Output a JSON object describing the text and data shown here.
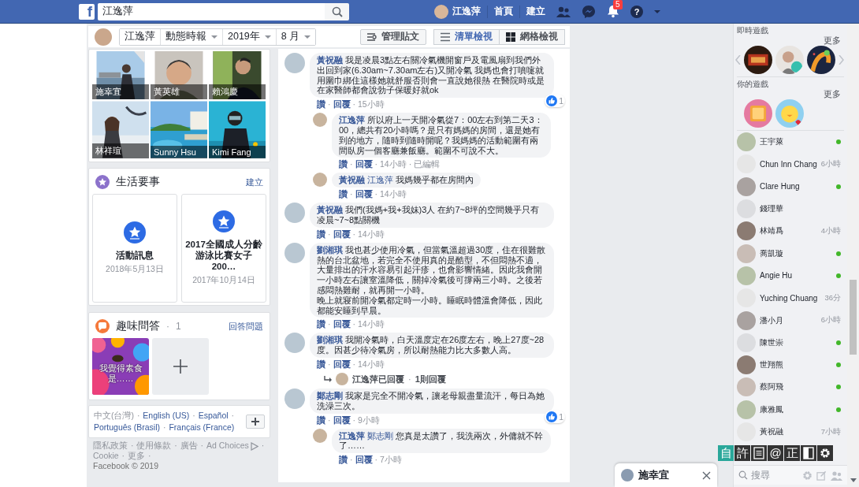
{
  "separator": "·",
  "topbar": {
    "logo": "f",
    "search": {
      "value": "江逸萍"
    },
    "profile_name": "江逸萍",
    "nav": [
      "首頁",
      "建立"
    ],
    "notification_count": "5",
    "help": "?"
  },
  "subheader": {
    "segments": [
      {
        "label": "江逸萍",
        "dropdown": false
      },
      {
        "label": "動態時報",
        "dropdown": true
      },
      {
        "label": "2019年",
        "dropdown": true
      },
      {
        "label": "8 月",
        "dropdown": true
      }
    ],
    "manage_button": "管理貼文",
    "views": [
      {
        "label": "清單檢視",
        "kind": "list",
        "selected": true
      },
      {
        "label": "網格檢視",
        "kind": "grid",
        "selected": false
      }
    ]
  },
  "friends": [
    {
      "name": "施幸宜",
      "kind": "beach"
    },
    {
      "name": "黃英雄",
      "kind": "portrait"
    },
    {
      "name": "賴鴻慶",
      "kind": "dark"
    },
    {
      "name": "林祥瑄",
      "kind": "poster"
    },
    {
      "name": "Sunny Hsu",
      "kind": "pool"
    },
    {
      "name": "Kimi Fang",
      "kind": "dive"
    }
  ],
  "life_events": {
    "title": "生活要事",
    "action": "建立",
    "items": [
      {
        "title": "活動訊息",
        "date": "2018年5月13日"
      },
      {
        "title": "2017全國成人分齡游泳比賽女子200…",
        "date": "2017年10月14日"
      }
    ]
  },
  "quiz": {
    "title": "趣味問答",
    "count": "1",
    "action": "回答問題",
    "caption": "我覺得素食是……"
  },
  "languages": [
    {
      "label": "中文(台灣)",
      "current": true
    },
    {
      "label": "English (US)",
      "current": false
    },
    {
      "label": "Español",
      "current": false
    },
    {
      "label": "Português (Brasil)",
      "current": false
    },
    {
      "label": "Français (France)",
      "current": false
    }
  ],
  "footer": {
    "links": [
      "隱私政策",
      "使用條款",
      "廣告",
      "Ad Choices",
      "Cookie",
      "更多"
    ],
    "copyright": "Facebook © 2019"
  },
  "comments": [
    {
      "author": "黃祝融",
      "text": "我是凌晨3點左右關冷氣機開窗戶及電風扇到我們外出回到家(6.30am~7.30am左右)又開冷氣 我媽也會打噴嚏就用圍巾綁住這樣她就舒服否則會一直說她很熱 在醫院時或是在家醫師都會說勃子保暖好就ok",
      "actions": [
        "讚",
        "回覆"
      ],
      "time": "15小時",
      "reactions": "1",
      "children": [
        {
          "author": "江逸萍",
          "text": "所以府上一天開冷氣從7：00左右到第二天3：00，總共有20小時嗎？是只有媽媽的房間，還是她有到的地方，隨時到隨時開呢？我媽媽的活動範圍有兩間臥房一個客廳兼飯廳。範圍不可說不大。",
          "actions": [
            "讚",
            "回覆"
          ],
          "time": "14小時",
          "edited": "已編輯"
        },
        {
          "author": "黃祝融",
          "mention": "江逸萍",
          "text": "我媽幾乎都在房間內",
          "actions": [
            "讚",
            "回覆"
          ],
          "time": "14小時"
        }
      ]
    },
    {
      "author": "黃祝融",
      "text": "我們(我媽+我+我妹)3人 在約7~8坪的空間幾乎只有凌晨~7~8點關機",
      "actions": [
        "讚",
        "回覆"
      ],
      "time": "14小時"
    },
    {
      "author": "劉湘琪",
      "text": "我也甚少使用冷氣，但當氣溫超過30度，住在很難散熱的台北盆地，若完全不使用真的是酷型，不但悶熱不適，大量排出的汗水容易引起汗疹，也會影響情緒。因此我會開一小時左右讓室溫降低，關掉冷氣後可撐兩三小時。之後若感悶熱難耐，就再開一小時。",
      "second_paragraph": "晚上就寢前開冷氣都定時一小時。睡眠時體溫會降低，因此都能安睡到早晨。",
      "actions": [
        "讚",
        "回覆"
      ],
      "time": "14小時"
    },
    {
      "author": "劉湘琪",
      "text": "我開冷氣時，白天溫度定在26度左右，晚上27度~28度。因甚少待冷氣房，所以耐熱能力比大多數人高。",
      "actions": [
        "讚",
        "回覆"
      ],
      "time": "14小時",
      "replies_summary": {
        "text": "江逸萍已回覆",
        "count": "1則回覆"
      }
    },
    {
      "author": "鄭志剛",
      "text": "我家是完全不開冷氣，讓老母親盡量流汗，每日為她洗澡三次。",
      "actions": [
        "讚",
        "回覆"
      ],
      "time": "9小時",
      "reactions": "1",
      "children": [
        {
          "author": "江逸萍",
          "mention": "鄭志剛",
          "text": "您真是太讚了，我洗兩次，外傭就不幹了……",
          "actions": [
            "讚",
            "回覆"
          ],
          "time": "7小時"
        }
      ]
    }
  ],
  "sidebar": {
    "live_games": {
      "title": "即時遊戲",
      "more": "更多"
    },
    "your_games": {
      "title": "你的遊戲",
      "more": "更多"
    },
    "contacts": [
      {
        "name": "王宇萊",
        "online": true
      },
      {
        "name": "Chun Inn Chang",
        "online": false,
        "last_active": "6小時"
      },
      {
        "name": "Clare Hung",
        "online": true
      },
      {
        "name": "錢理華",
        "online": false
      },
      {
        "name": "林靖爲",
        "online": false,
        "last_active": "4小時"
      },
      {
        "name": "喬凱璇",
        "online": true
      },
      {
        "name": "Angie Hu",
        "online": true
      },
      {
        "name": "Yuching Chuang",
        "online": false,
        "last_active": "36分"
      },
      {
        "name": "潘小月",
        "online": false,
        "last_active": "6小時"
      },
      {
        "name": "陳世崇",
        "online": true
      },
      {
        "name": "世翔熊",
        "online": true
      },
      {
        "name": "蔡阿飛",
        "online": true
      },
      {
        "name": "康雅鳳",
        "online": true
      },
      {
        "name": "黃祝融",
        "online": false,
        "last_active": "7小時"
      }
    ],
    "toolbar": [
      {
        "kind": "text",
        "label": "自",
        "selected": true
      },
      {
        "kind": "text",
        "label": "許",
        "selected": false
      },
      {
        "kind": "list",
        "selected": false
      },
      {
        "kind": "text",
        "label": "@",
        "selected": false
      },
      {
        "kind": "text",
        "label": "正",
        "selected": false
      },
      {
        "kind": "contrast",
        "selected": false
      },
      {
        "kind": "gear",
        "selected": false
      }
    ],
    "search": {
      "placeholder": "搜尋"
    }
  },
  "chat_tab": {
    "name": "施幸宜"
  }
}
